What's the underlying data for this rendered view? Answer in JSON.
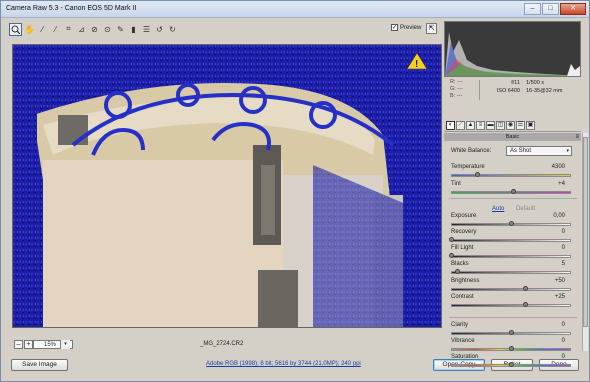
{
  "window": {
    "title": "Camera Raw 5.3  -  Canon EOS 5D Mark II",
    "minimize": "–",
    "maximize": "□",
    "close": "✕"
  },
  "toolbar": {
    "tools": [
      "zoom-tool",
      "hand-tool",
      "white-balance-tool",
      "color-sampler-tool",
      "crop-tool",
      "straighten-tool",
      "spot-removal-tool",
      "red-eye-tool",
      "adjustment-brush-tool",
      "graduated-filter-tool",
      "preferences-tool",
      "rotate-ccw-tool",
      "rotate-cw-tool"
    ],
    "preview_label": "Preview",
    "preview_checked": "✓"
  },
  "canvas": {
    "warning_glyph": "!"
  },
  "status": {
    "zoom_minus": "–",
    "zoom_plus": "+",
    "zoom_value": "15%",
    "zoom_arrow": "▾",
    "filename": "_MG_2724.CR2"
  },
  "bottom": {
    "save_label": "Save Image",
    "info_link": "Adobe RGB (1998); 8 bit; 5616 by 3744 (21,0MP); 240 ppi",
    "open_label": "Open Copy",
    "reset_label": "Reset",
    "done_label": "Done"
  },
  "readout": {
    "r": "R:   ---",
    "g": "G:   ---",
    "b": "B:   ---",
    "aperture": "f/11",
    "shutter": "1/500 s",
    "iso": "ISO 6400",
    "lens": "16-35@32 mm"
  },
  "panel": {
    "title": "Basic",
    "wb_label": "White Balance:",
    "wb_value": "As Shot",
    "wb_arrow": "▾",
    "auto": "Auto",
    "default": "Default",
    "sliders": [
      {
        "label": "Temperature",
        "value": "4300",
        "pos": 0.22,
        "kind": "temp"
      },
      {
        "label": "Tint",
        "value": "+4",
        "pos": 0.52,
        "kind": "tint"
      },
      {
        "label": "Exposure",
        "value": "0,00",
        "pos": 0.5,
        "kind": "gray"
      },
      {
        "label": "Recovery",
        "value": "0",
        "pos": 0.0,
        "kind": "gray"
      },
      {
        "label": "Fill Light",
        "value": "0",
        "pos": 0.0,
        "kind": "gray"
      },
      {
        "label": "Blacks",
        "value": "5",
        "pos": 0.05,
        "kind": "gray"
      },
      {
        "label": "Brightness",
        "value": "+50",
        "pos": 0.62,
        "kind": "gray"
      },
      {
        "label": "Contrast",
        "value": "+25",
        "pos": 0.62,
        "kind": "gray"
      },
      {
        "label": "Clarity",
        "value": "0",
        "pos": 0.5,
        "kind": "gray"
      },
      {
        "label": "Vibrance",
        "value": "0",
        "pos": 0.5,
        "kind": "vib"
      },
      {
        "label": "Saturation",
        "value": "0",
        "pos": 0.5,
        "kind": "sat"
      }
    ],
    "tab_icons": [
      "basic-tab-icon",
      "tone-curve-tab-icon",
      "detail-tab-icon",
      "hsl-tab-icon",
      "split-toning-tab-icon",
      "lens-corrections-tab-icon",
      "camera-calibration-tab-icon",
      "presets-tab-icon",
      "snapshots-tab-icon"
    ]
  },
  "colors": {
    "clipping_overlay": "#1c1fa6",
    "accent_link": "#1a3fa8"
  }
}
